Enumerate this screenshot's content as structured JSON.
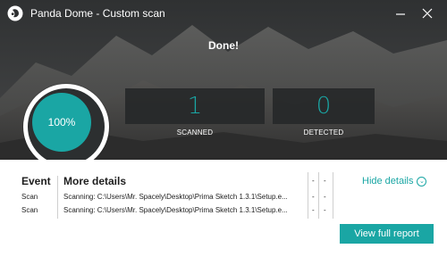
{
  "window": {
    "title": "Panda Dome - Custom scan",
    "icons": {
      "logo": "panda-logo",
      "minimize": "minimize-icon",
      "close": "close-icon"
    }
  },
  "status": {
    "text": "Done!"
  },
  "progress": {
    "label": "100%",
    "value": 1.0
  },
  "counters": {
    "scanned": {
      "value": "1",
      "label": "SCANNED"
    },
    "detected": {
      "value": "0",
      "label": "DETECTED"
    }
  },
  "details": {
    "columns": {
      "event": "Event",
      "more": "More details"
    },
    "rows": [
      {
        "event": "Scan",
        "detail": "Scanning: C:\\Users\\Mr. Spacely\\Desktop\\Prima Sketch 1.3.1\\Setup.e...",
        "c1": "-",
        "c2": "-"
      },
      {
        "event": "Scan",
        "detail": "Scanning: C:\\Users\\Mr. Spacely\\Desktop\\Prima Sketch 1.3.1\\Setup.e...",
        "c1": "-",
        "c2": "-"
      }
    ],
    "extra_header": {
      "c1": "-",
      "c2": "-"
    },
    "hide_label": "Hide details"
  },
  "actions": {
    "report_label": "View full report"
  },
  "colors": {
    "accent": "#1aa6a4",
    "hero_dark": "#353535"
  }
}
